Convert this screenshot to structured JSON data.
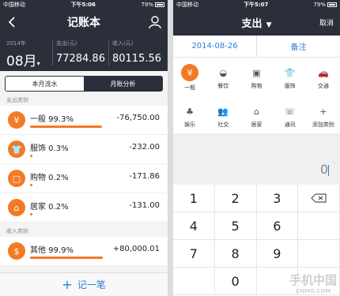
{
  "left": {
    "status": {
      "carrier": "中国移动",
      "time": "下午5:06",
      "battery": "79%"
    },
    "title": "记账本",
    "summary": {
      "year": "2014年",
      "month": "08月",
      "expense_label": "支出(元)",
      "expense": "77284.86",
      "income_label": "收入(元)",
      "income": "80115.56"
    },
    "tabs": [
      "本月流水",
      "月账分析"
    ],
    "expense_section": "支出类别",
    "expense_items": [
      {
        "name": "一般 99.3%",
        "amount": "-76,750.00",
        "icon": "yuan-icon",
        "bar": 0.993
      },
      {
        "name": "服饰 0.3%",
        "amount": "-232.00",
        "icon": "clothes-icon",
        "bar": 0.003
      },
      {
        "name": "购物 0.2%",
        "amount": "-171.86",
        "icon": "shopping-icon",
        "bar": 0.002
      },
      {
        "name": "居家 0.2%",
        "amount": "-131.00",
        "icon": "sofa-icon",
        "bar": 0.002
      }
    ],
    "income_section": "收入类别",
    "income_items": [
      {
        "name": "其他 99.9%",
        "amount": "+80,000.01",
        "icon": "money-icon",
        "bar": 0.999
      }
    ],
    "add_label": "记一笔",
    "accent": "#f37a24"
  },
  "right": {
    "status": {
      "carrier": "中国移动",
      "time": "下午5:07",
      "battery": "79%"
    },
    "title": "支出",
    "cancel": "取消",
    "date": "2014-08-26",
    "note": "备注",
    "categories": [
      "一般",
      "餐饮",
      "购物",
      "服饰",
      "交通",
      "娱乐",
      "社交",
      "居家",
      "通讯",
      "添加类别"
    ],
    "amount": "0",
    "keys": [
      "1",
      "2",
      "3",
      "",
      "4",
      "5",
      "6",
      "",
      "7",
      "8",
      "9",
      "",
      "",
      "0",
      "",
      ""
    ],
    "watermark": "手机中国",
    "watermark_sub": "CNMO.COM"
  }
}
